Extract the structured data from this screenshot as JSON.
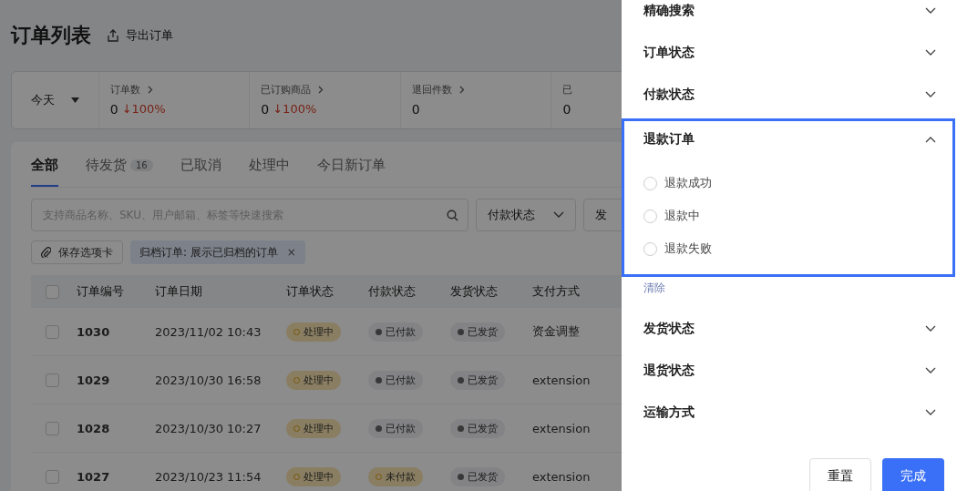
{
  "page": {
    "title": "订单列表",
    "export_label": "导出订单"
  },
  "stats": {
    "period": "今天",
    "items": [
      {
        "label": "订单数",
        "value": "0",
        "change": "↓100%"
      },
      {
        "label": "已订购商品",
        "value": "0",
        "change": "↓100%"
      },
      {
        "label": "退回件数",
        "value": "0"
      },
      {
        "label": "已",
        "value": "0"
      }
    ]
  },
  "tabs": [
    {
      "label": "全部",
      "selected": true
    },
    {
      "label": "待发货",
      "count": "16",
      "selected": false
    },
    {
      "label": "已取消",
      "selected": false
    },
    {
      "label": "处理中",
      "selected": false
    },
    {
      "label": "今日新订单",
      "selected": false
    }
  ],
  "search": {
    "placeholder": "支持商品名称、SKU、用户邮箱、标签等快速搜索"
  },
  "filters": [
    {
      "label": "付款状态",
      "truncated": false
    },
    {
      "label": "发",
      "truncated": true
    }
  ],
  "save_tab": "保存选项卡",
  "chips": [
    {
      "label": "归档订单: 展示已归档的订单",
      "close": "×"
    }
  ],
  "table": {
    "all_checked": false,
    "columns": [
      "订单编号",
      "订单日期",
      "订单状态",
      "付款状态",
      "发货状态",
      "支付方式"
    ],
    "rows": [
      {
        "checked": false,
        "id": "1030",
        "date": "2023/11/02 10:43",
        "order_status": {
          "label": "处理中",
          "kind": "pending"
        },
        "payment_status": {
          "label": "已付款",
          "kind": "done"
        },
        "shipping_status": {
          "label": "已发货",
          "kind": "done"
        },
        "method": "资金调整"
      },
      {
        "checked": false,
        "id": "1029",
        "date": "2023/10/30 16:58",
        "order_status": {
          "label": "处理中",
          "kind": "pending"
        },
        "payment_status": {
          "label": "已付款",
          "kind": "done"
        },
        "shipping_status": {
          "label": "已发货",
          "kind": "done"
        },
        "method": "extension"
      },
      {
        "checked": false,
        "id": "1028",
        "date": "2023/10/30 10:27",
        "order_status": {
          "label": "处理中",
          "kind": "pending"
        },
        "payment_status": {
          "label": "已付款",
          "kind": "done"
        },
        "shipping_status": {
          "label": "已发货",
          "kind": "done"
        },
        "method": "extension"
      },
      {
        "checked": false,
        "id": "1027",
        "date": "2023/10/23 11:54",
        "order_status": {
          "label": "处理中",
          "kind": "pending"
        },
        "payment_status": {
          "label": "未付款",
          "kind": "pending"
        },
        "shipping_status": {
          "label": "已发货",
          "kind": "done"
        },
        "method": "extension"
      }
    ]
  },
  "drawer": {
    "sections": [
      {
        "title": "精确搜索",
        "expanded": false,
        "focused": false
      },
      {
        "title": "订单状态",
        "expanded": false,
        "focused": false
      },
      {
        "title": "付款状态",
        "expanded": false,
        "focused": false
      },
      {
        "title": "退款订单",
        "expanded": true,
        "focused": true,
        "options": [
          {
            "label": "退款成功",
            "selected": false
          },
          {
            "label": "退款中",
            "selected": false
          },
          {
            "label": "退款失败",
            "selected": false
          }
        ],
        "clear": "清除"
      },
      {
        "title": "发货状态",
        "expanded": false,
        "focused": false
      },
      {
        "title": "退货状态",
        "expanded": false,
        "focused": false
      },
      {
        "title": "运输方式",
        "expanded": false,
        "focused": false
      }
    ],
    "buttons": [
      {
        "label": "重置",
        "kind": "secondary"
      },
      {
        "label": "完成",
        "kind": "primary"
      }
    ]
  }
}
